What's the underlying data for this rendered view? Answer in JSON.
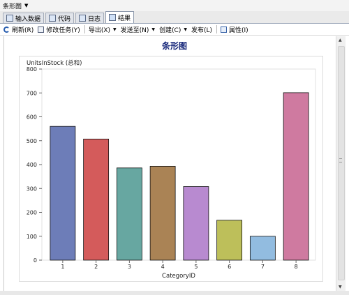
{
  "window": {
    "title": "条形图"
  },
  "tabs": [
    {
      "label": "输入数据",
      "icon": "table-icon"
    },
    {
      "label": "代码",
      "icon": "code-icon"
    },
    {
      "label": "日志",
      "icon": "log-icon"
    },
    {
      "label": "结果",
      "icon": "results-icon"
    }
  ],
  "toolbar": {
    "refresh": "刷新(R)",
    "modify_task": "修改任务(Y)",
    "export": "导出(X)",
    "send_to": "发送至(N)",
    "create": "创建(C)",
    "publish": "发布(L)",
    "properties": "属性(I)"
  },
  "colors": {
    "bars": [
      "#6d7db8",
      "#d45b5b",
      "#67a7a1",
      "#aa8355",
      "#b88ad0",
      "#bdbf5a",
      "#92bce0",
      "#cf7aa0"
    ],
    "title": "#112277"
  },
  "chart_data": {
    "type": "bar",
    "title": "条形图",
    "ylabel": "UnitsInStock (总和)",
    "xlabel": "CategoryID",
    "categories": [
      "1",
      "2",
      "3",
      "4",
      "5",
      "6",
      "7",
      "8"
    ],
    "values": [
      560,
      507,
      386,
      393,
      308,
      167,
      100,
      701
    ],
    "ylim": [
      0,
      800
    ],
    "yticks": [
      0,
      100,
      200,
      300,
      400,
      500,
      600,
      700,
      800
    ],
    "grid": false
  }
}
